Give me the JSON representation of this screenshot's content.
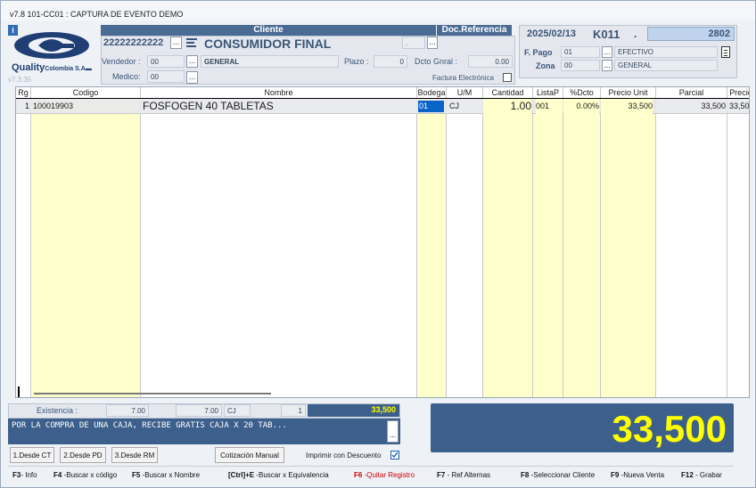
{
  "window": {
    "title": "v7.8 101-CC01 : CAPTURA DE EVENTO DEMO",
    "version": "v7.3.35"
  },
  "logo": {
    "text": "Quality",
    "sub": "Colombia S.A"
  },
  "cliente": {
    "header": "Cliente",
    "nit": "22222222222",
    "nombre": "CONSUMIDOR FINAL",
    "vendedor_label": "Vendedor :",
    "vendedor_code": "00",
    "vendedor_name": "GENERAL",
    "medico_label": "Medico:",
    "medico_code": "00",
    "plazo_label": "Plazo :",
    "plazo_value": "0",
    "dcto_label": "Dcto Gnral :",
    "dcto_value": "0.00",
    "factura_label": "Factura Electrónica",
    "dots": "..."
  },
  "docref": {
    "header": "Doc.Referencia",
    "value": "."
  },
  "doc": {
    "fecha": "2025/02/13",
    "codigo": "K011",
    "sep": ".",
    "numero": "2802",
    "fpago_label": "F. Pago",
    "fpago_code": "01",
    "fpago_name": "EFECTIVO",
    "zona_label": "Zona",
    "zona_code": "00",
    "zona_name": "GENERAL"
  },
  "table": {
    "headers": [
      "Rg",
      "Codigo",
      "Nombre",
      "Bodega",
      "U/M",
      "Cantidad",
      "ListaP",
      "%Dcto",
      "Precio Unit",
      "Parcial",
      "Precio"
    ],
    "rows": [
      {
        "rg": "1",
        "codigo": "100019903",
        "nombre": "FOSFOGEN 40 TABLETAS",
        "bodega": "01",
        "um": "CJ",
        "cantidad": "1.00",
        "listap": "001",
        "dcto": "0.00%",
        "precio_unit": "33,500",
        "parcial": "33,500",
        "precio": "33,50"
      }
    ]
  },
  "footer": {
    "existencia_label": "Existencia :",
    "ex1": "7.00",
    "ex2": "7.00",
    "ex_um": "CJ",
    "ex_n": "1",
    "ex_total": "33,500",
    "mensaje": "POR LA COMPRA DE UNA CAJA, RECIBE GRATIS CAJA X 20 TAB...",
    "total": "33,500",
    "buttons": [
      "1.Desde CT",
      "2.Desde PD",
      "3.Desde RM"
    ],
    "cotizacion": "Cotización Manual",
    "imprimir": "Imprimir con Descuento"
  },
  "fkeys": [
    {
      "k": "F3",
      "t": "- Info"
    },
    {
      "k": "F4",
      "t": " -Buscar x código"
    },
    {
      "k": "F5",
      "t": " -Buscar x Nombre"
    },
    {
      "k": "[Ctrl]+E",
      "t": " -Buscar x Equivalencia"
    },
    {
      "k": "F6",
      "t": " -Quitar Registro"
    },
    {
      "k": "F7",
      "t": " - Ref Alternas"
    },
    {
      "k": "F8",
      "t": " -Seleccionar Cliente"
    },
    {
      "k": "F9",
      "t": " -Nueva Venta"
    },
    {
      "k": "F12",
      "t": " - Grabar"
    }
  ],
  "colors": {
    "header_blue": "#4a6b94",
    "yellow_col": "#ffffcc",
    "total_text": "#ffff00",
    "fk_red": "#cc0000"
  }
}
